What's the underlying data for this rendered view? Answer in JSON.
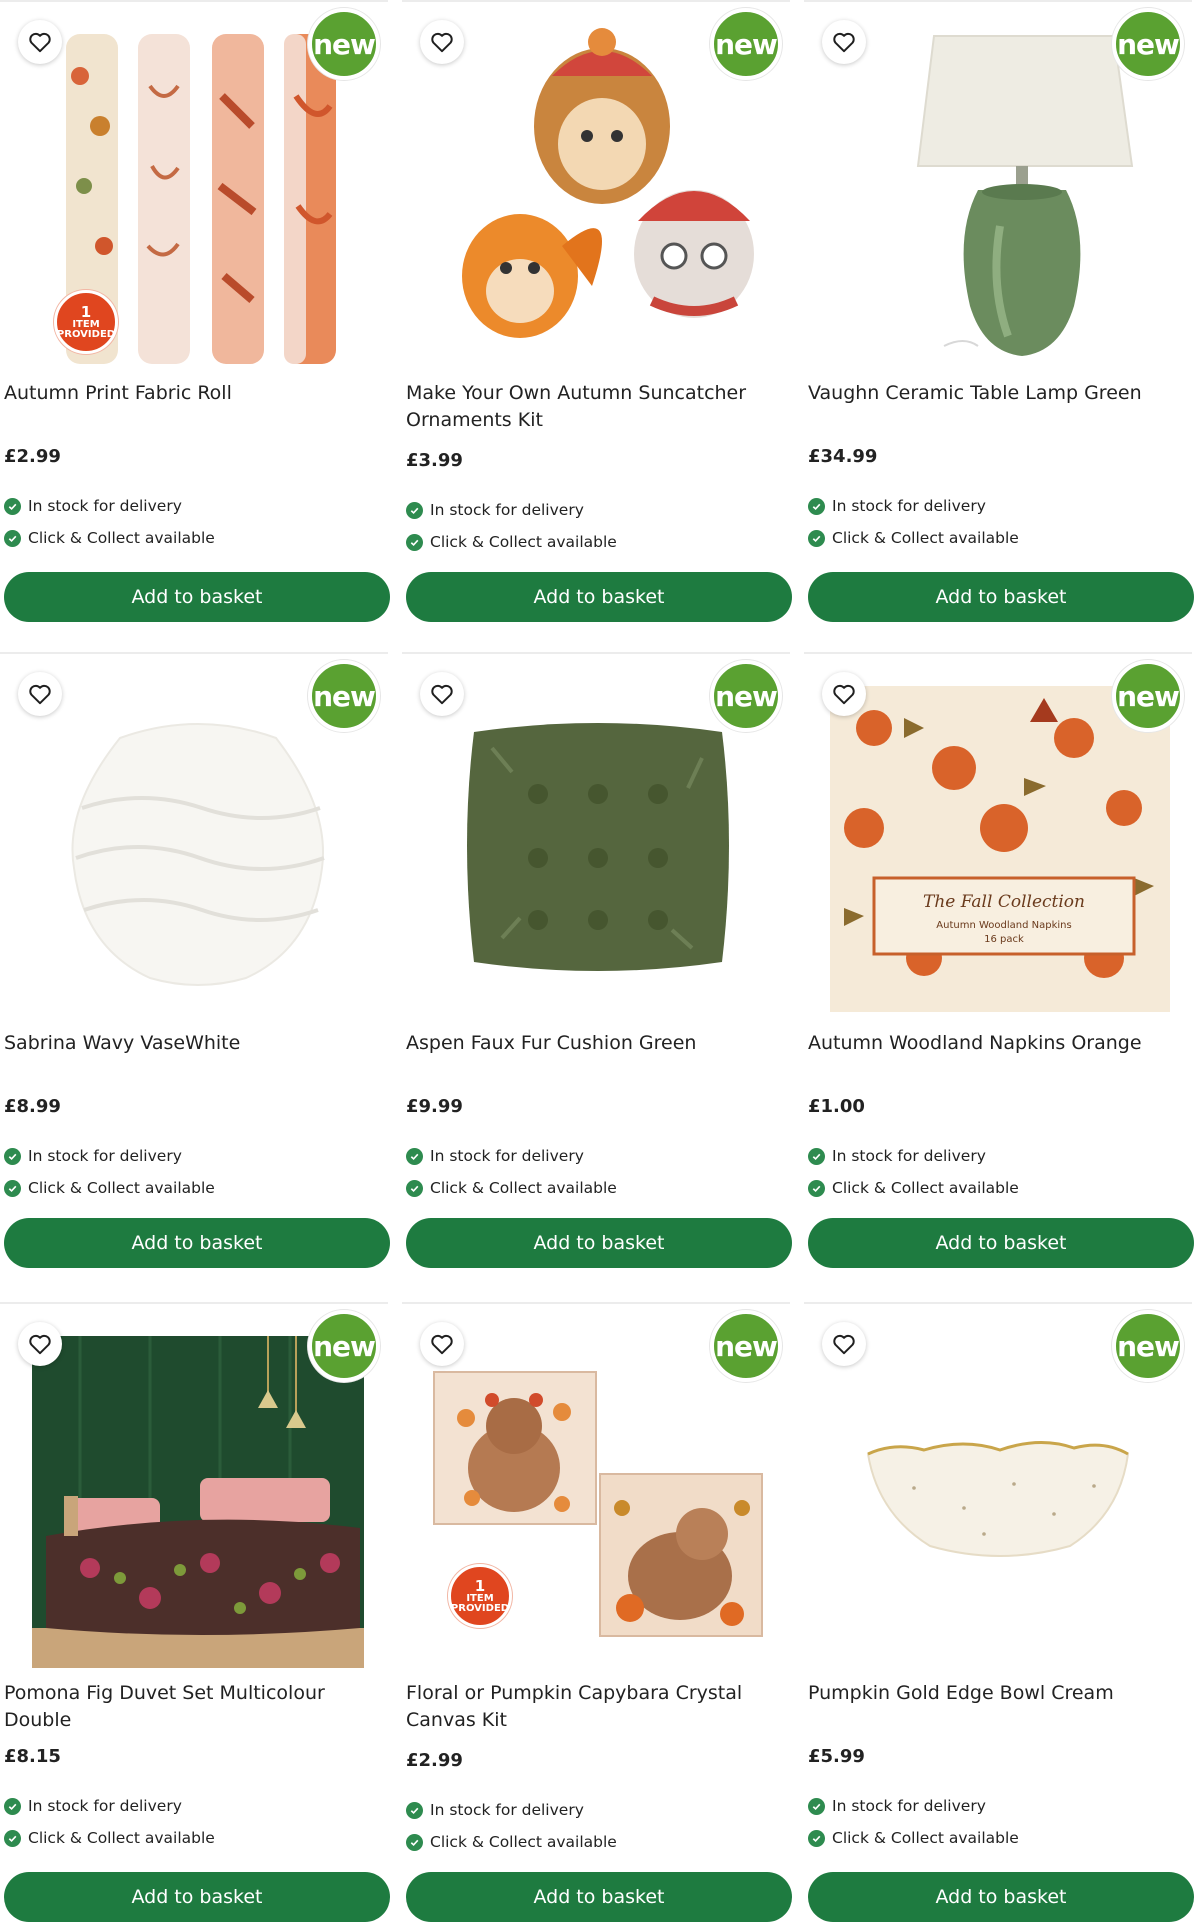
{
  "colors": {
    "primary_green": "#1e7b40",
    "new_badge": "#5aa131",
    "item_badge": "#e0461f",
    "stock_tick": "#2e8b4f"
  },
  "labels": {
    "new": "new",
    "add_to_basket": "Add to basket",
    "in_stock": "In stock for delivery",
    "click_collect": "Click & Collect available",
    "item_badge_n": "1",
    "item_badge_word1": "ITEM",
    "item_badge_word2": "PROVIDED"
  },
  "products": [
    {
      "name": "Autumn Print Fabric Roll",
      "price": "£2.99",
      "image": "fabric-rolls-image"
    },
    {
      "name": "Make Your Own Autumn Suncatcher Ornaments Kit",
      "price": "£3.99",
      "image": "suncatcher-animals-image"
    },
    {
      "name": "Vaughn Ceramic Table Lamp Green",
      "price": "£34.99",
      "image": "green-lamp-image"
    },
    {
      "name": "Sabrina Wavy VaseWhite",
      "price": "£8.99",
      "image": "white-vase-image"
    },
    {
      "name": "Aspen Faux Fur Cushion Green",
      "price": "£9.99",
      "image": "green-cushion-image"
    },
    {
      "name": "Autumn Woodland Napkins Orange",
      "price": "£1.00",
      "image": "napkins-image",
      "image_text": {
        "title": "The Fall Collection",
        "line1": "Autumn Woodland Napkins",
        "line2": "16 pack"
      }
    },
    {
      "name": "Pomona Fig Duvet Set Multicolour Double",
      "price": "£8.15",
      "image": "duvet-bedroom-image"
    },
    {
      "name": "Floral or Pumpkin Capybara Crystal Canvas Kit",
      "price": "£2.99",
      "image": "capybara-canvas-image"
    },
    {
      "name": "Pumpkin Gold Edge Bowl Cream",
      "price": "£5.99",
      "image": "cream-bowl-image"
    }
  ]
}
